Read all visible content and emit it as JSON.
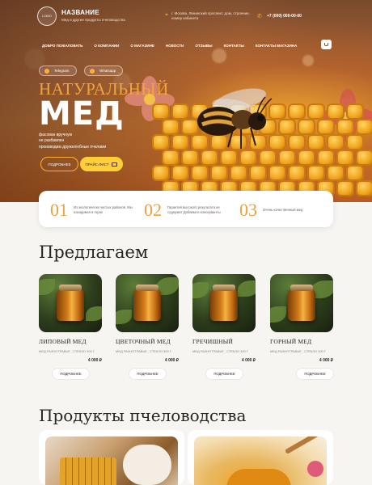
{
  "header": {
    "logo_text": "LOGO",
    "brand_name": "НАЗВАНИЕ",
    "brand_sub": "Мед и другие продукты пчеловодства",
    "address": "г. Москва, Ленинский проспект, дом, строение, номер кабинета",
    "phone": "+7 (000) 000-00-00"
  },
  "nav": [
    "ДОБРО ПОЖАЛОВАТЬ",
    "О КОМПАНИИ",
    "О МАГАЗИНЕ",
    "НОВОСТИ",
    "ОТЗЫВЫ",
    "КОНТАКТЫ",
    "КОНТАКТЫ МАГАЗИНА"
  ],
  "pills": {
    "telegram": "Telegram",
    "whatsapp": "Whatsapp"
  },
  "hero": {
    "title_line1": "НАТУРАЛЬНЫЙ",
    "title_line2": "МЕД",
    "desc": [
      "фасован вручную",
      "не разбавлен",
      "производим дружелюбные пчелами"
    ],
    "btn_more": "ПОДРОБНЕЕ",
    "btn_price": "ПРАЙС-ЛИСТ"
  },
  "features": [
    {
      "num": "01",
      "text": "Из экологически чистых районов. Мы находимся в горах"
    },
    {
      "num": "02",
      "text": "Гарантия высокого результата не содержит Добавки и консерванты"
    },
    {
      "num": "03",
      "text": "Очень качественный мед"
    }
  ],
  "section1_title": "Предлагаем",
  "products": [
    {
      "name": "ЛИПОВЫЙ МЕД",
      "meta": "МЕД РАЗНОТРАВЬЕ , СТЕКЛО 300 Г",
      "price": "4 000 ₽",
      "btn": "ПОДРОБНЕЕ"
    },
    {
      "name": "ЦВЕТОЧНЫЙ МЕД",
      "meta": "МЕД РАЗНОТРАВЬЕ , СТЕКЛО 300 Г",
      "price": "4 000 ₽",
      "btn": "ПОДРОБНЕЕ"
    },
    {
      "name": "ГРЕЧИШНЫЙ",
      "meta": "МЕД РАЗНОТРАВЬЕ , СТЕКЛО 300 Г",
      "price": "4 000 ₽",
      "btn": "ПОДРОБНЕЕ"
    },
    {
      "name": "ГОРНЫЙ МЕД",
      "meta": "МЕД РАЗНОТРАВЬЕ , СТЕКЛО 300 Г",
      "price": "4 000 ₽",
      "btn": "ПОДРОБНЕЕ"
    }
  ],
  "section2_title": "Продукты пчеловодства",
  "colors": {
    "accent": "#eaa03c",
    "button_yellow": "#ffcf3a",
    "text_dark": "#2a2520"
  }
}
